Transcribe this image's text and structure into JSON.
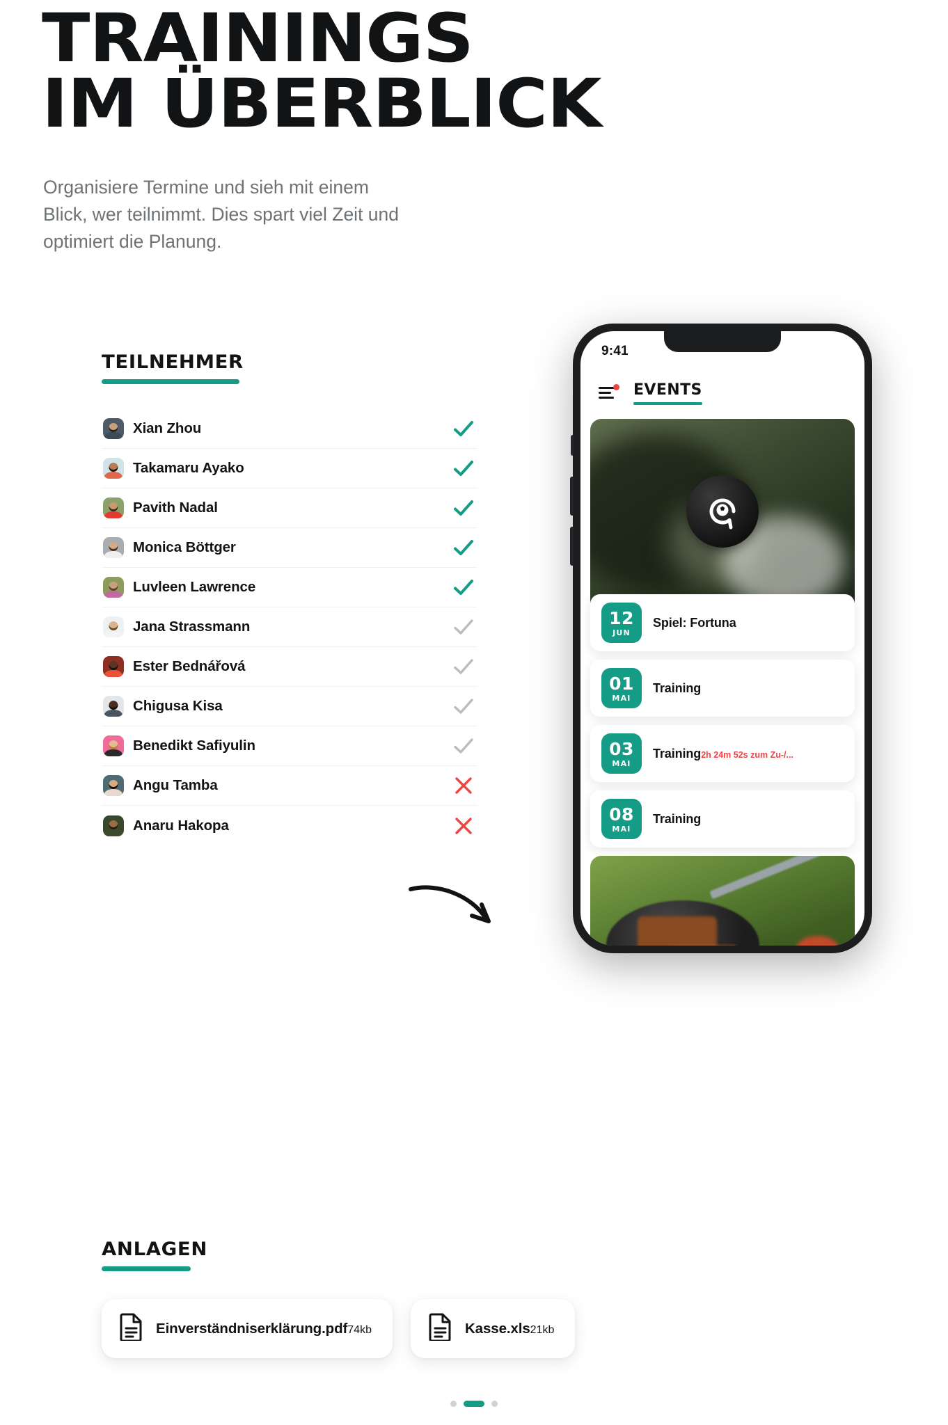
{
  "headline": {
    "line1": "TRAININGS",
    "line2": "IM ÜBERBLICK"
  },
  "subtitle": "Organisiere Termine und sieh mit einem Blick, wer teilnimmt. Dies spart viel Zeit und optimiert die Planung.",
  "accent_color": "#159c86",
  "danger_color": "#ef4444",
  "muted_color": "#b9bdc0",
  "participants": {
    "heading": "TEILNEHMER",
    "rows": [
      {
        "name": "Xian Zhou",
        "status": "accepted",
        "skin": "#caa07c",
        "hair": "#2b2118",
        "shirt": "#3d4a58",
        "bg": "#4e5a66"
      },
      {
        "name": "Takamaru Ayako",
        "status": "accepted",
        "skin": "#b97c52",
        "hair": "#1d1712",
        "shirt": "#e0674f",
        "bg": "#cfe3e8"
      },
      {
        "name": "Pavith Nadal",
        "status": "accepted",
        "skin": "#c99a6e",
        "hair": "#3a2a18",
        "shirt": "#e03a32",
        "bg": "#8ba36a"
      },
      {
        "name": "Monica Böttger",
        "status": "accepted",
        "skin": "#d3ab86",
        "hair": "#463326",
        "shirt": "#efefef",
        "bg": "#a8adb2"
      },
      {
        "name": "Luvleen Lawrence",
        "status": "accepted",
        "skin": "#caa07c",
        "hair": "#5a3f25",
        "shirt": "#c06ba0",
        "bg": "#8d9b5c"
      },
      {
        "name": "Jana Strassmann",
        "status": "pending",
        "skin": "#dcb28c",
        "hair": "#6b4a2c",
        "shirt": "#f4f4f4",
        "bg": "#eef1f3"
      },
      {
        "name": "Ester Bednářová",
        "status": "pending",
        "skin": "#5a3523",
        "hair": "#1a120c",
        "shirt": "#e8533a",
        "bg": "#8e2f22"
      },
      {
        "name": "Chigusa Kisa",
        "status": "pending",
        "skin": "#4a2f1f",
        "hair": "#141009",
        "shirt": "#4a5560",
        "bg": "#e3e6e8"
      },
      {
        "name": "Benedikt Safiyulin",
        "status": "pending",
        "skin": "#e3bb95",
        "hair": "#b4802f",
        "shirt": "#2a2a2a",
        "bg": "#f06a9a"
      },
      {
        "name": "Angu Tamba",
        "status": "declined",
        "skin": "#d6ab84",
        "hair": "#15100b",
        "shirt": "#e8d9cc",
        "bg": "#4d6b70"
      },
      {
        "name": "Anaru Hakopa",
        "status": "declined",
        "skin": "#9c6b45",
        "hair": "#241a10",
        "shirt": "#3c4a2e",
        "bg": "#39472c"
      }
    ]
  },
  "attachments": {
    "heading": "ANLAGEN",
    "files": [
      {
        "name": "Einverständniserklärung.pdf",
        "size": "74kb"
      },
      {
        "name": "Kasse.xls",
        "size": "21kb"
      }
    ]
  },
  "pagination": {
    "dots": 3,
    "active_index": 1
  },
  "phone": {
    "status_time": "9:41",
    "app_tab": "EVENTS",
    "events": [
      {
        "day": "12",
        "month": "JUN",
        "title": "Spiel: Fortuna",
        "sub": ""
      },
      {
        "day": "01",
        "month": "MAI",
        "title": "Training",
        "sub": ""
      },
      {
        "day": "03",
        "month": "MAI",
        "title": "Training",
        "sub": "2h 24m 52s zum Zu-/..."
      },
      {
        "day": "08",
        "month": "MAI",
        "title": "Training",
        "sub": ""
      }
    ]
  }
}
